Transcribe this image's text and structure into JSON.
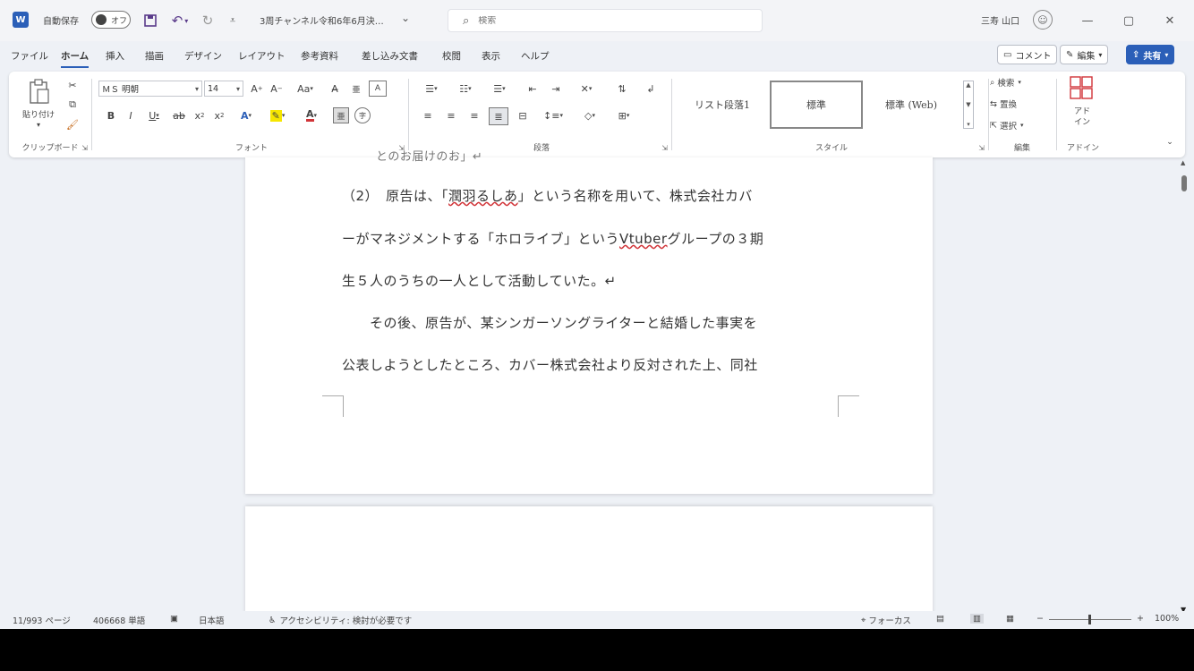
{
  "titlebar": {
    "autosave_label": "自動保存",
    "autosave_state": "オフ",
    "document_title": "3周チャンネル令和6年6月決…",
    "search_placeholder": "検索",
    "user_name": "三寿 山口"
  },
  "tabs": [
    {
      "label": "ファイル"
    },
    {
      "label": "ホーム",
      "active": true
    },
    {
      "label": "挿入"
    },
    {
      "label": "描画"
    },
    {
      "label": "デザイン"
    },
    {
      "label": "レイアウト"
    },
    {
      "label": "参考資料"
    },
    {
      "label": "差し込み文書"
    },
    {
      "label": "校閲"
    },
    {
      "label": "表示"
    },
    {
      "label": "ヘルプ"
    }
  ],
  "menu_right": {
    "comment": "コメント",
    "edit": "編集",
    "share": "共有"
  },
  "ribbon": {
    "clipboard": {
      "paste": "貼り付け",
      "label": "クリップボード"
    },
    "font": {
      "name": "ＭＳ 明朝",
      "size": "14",
      "label": "フォント"
    },
    "paragraph": {
      "label": "段落"
    },
    "styles": {
      "items": [
        "リスト段落1",
        "標準",
        "標準 (Web)"
      ],
      "label": "スタイル"
    },
    "editing": {
      "find": "検索",
      "replace": "置換",
      "select": "選択",
      "label": "編集"
    },
    "addin": {
      "button": "アド イン",
      "label": "アドイン"
    }
  },
  "document": {
    "line0": "とのお届けのお」↵",
    "line1_a": "（2）　原告は、「",
    "line1_red": "潤羽るしあ",
    "line1_b": "」という名称を用いて、株式会社カバ",
    "line2_a": "ーがマネジメントする「ホロライブ」という",
    "line2_red": "Vtuber",
    "line2_b": "グループの３期",
    "line3": "生５人のうちの一人として活動していた。↵",
    "line4": "　　その後、原告が、某シンガーソングライターと結婚した事実を",
    "line5": "公表しようとしたところ、カバー株式会社より反対された上、同社"
  },
  "statusbar": {
    "pages": "11/993 ページ",
    "words": "406668 単語",
    "language": "日本語",
    "accessibility": "アクセシビリティ: 検討が必要です",
    "focus": "フォーカス",
    "zoom": "100%"
  },
  "colors": {
    "accent": "#2b5fb8",
    "spell_error": "#d13438"
  }
}
